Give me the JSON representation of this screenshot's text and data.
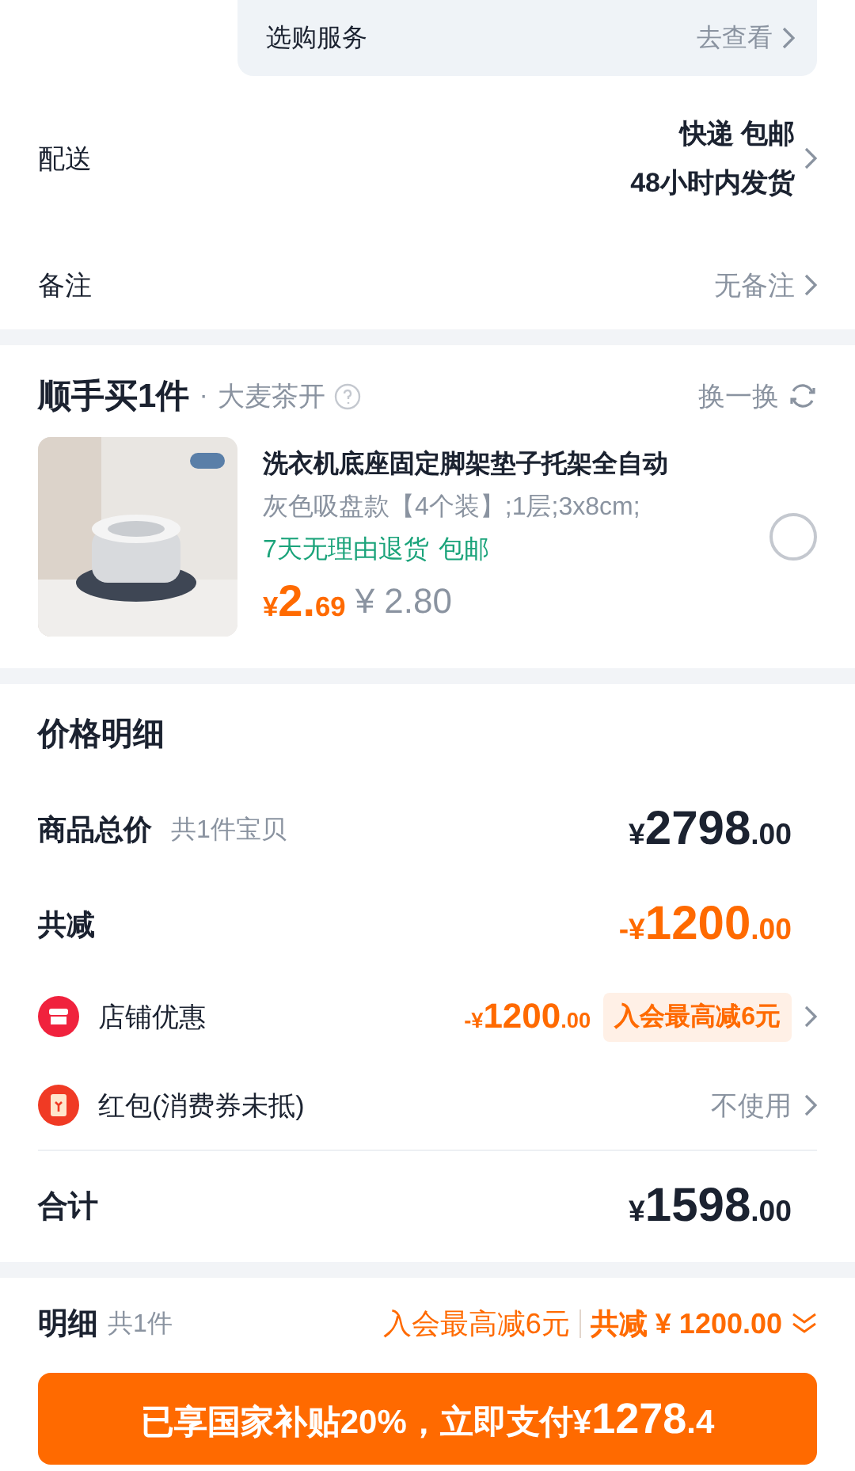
{
  "service": {
    "label": "选购服务",
    "action": "去查看"
  },
  "delivery": {
    "label": "配送",
    "lines": [
      "快递 包邮",
      "48小时内发货"
    ]
  },
  "note": {
    "label": "备注",
    "value": "无备注"
  },
  "bundle": {
    "title": "顺手买1件",
    "separator": "·",
    "subtitle": "大麦茶开",
    "swap": "换一换",
    "product": {
      "kind": "picture",
      "name": "洗衣机底座固定脚架垫子托架全自动",
      "spec": "灰色吸盘款【4个装】;1层;3x8cm;",
      "tags": [
        "7天无理由退货",
        "包邮"
      ],
      "price": {
        "prefix": "¥",
        "main": "2.",
        "fraction": "69"
      },
      "original_price": "¥ 2.80",
      "selected": false
    }
  },
  "price_details": {
    "title": "价格明细",
    "rows": [
      {
        "kind": "total",
        "label": "商品总价",
        "note": "共1件宝贝",
        "price": {
          "prefix": "¥",
          "main": "2798",
          "fraction": ".00"
        }
      },
      {
        "kind": "discount",
        "label": "共减",
        "price": {
          "prefix": "-¥",
          "main": "1200",
          "fraction": ".00"
        }
      },
      {
        "kind": "store",
        "label": "店铺优惠",
        "price": {
          "prefix": "-¥",
          "main": "1200",
          "fraction": ".00"
        },
        "badge": "入会最高减6元"
      },
      {
        "kind": "redpacket",
        "label": "红包(消费券未抵)",
        "value": "不使用"
      }
    ],
    "sum": {
      "label": "合计",
      "price": {
        "prefix": "¥",
        "main": "1598",
        "fraction": ".00"
      }
    }
  },
  "footer": {
    "label": "明细",
    "count": "共1件",
    "promo": "入会最高减6元",
    "discount": "共减 ¥ 1200.00",
    "pay_button": {
      "text": "已享国家补贴20%，立即支付¥",
      "main": "1278",
      "fraction": ".4"
    }
  }
}
